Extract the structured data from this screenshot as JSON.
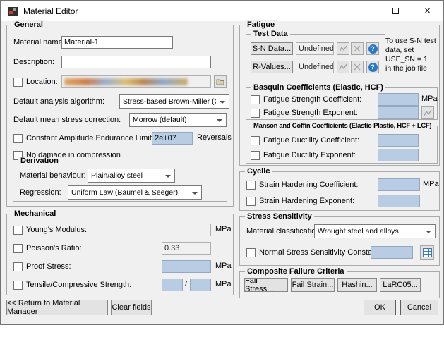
{
  "window": {
    "title": "Material Editor",
    "close_glyph": "×"
  },
  "icons": {
    "help_glyph": "?"
  },
  "colors": {
    "dialog_bg": "#f0f0f0",
    "field_blue": "#b8cce4",
    "help_icon_blue": "#2979c8",
    "calc_icon_blue": "#3b78c3"
  },
  "general": {
    "title": "General",
    "material_name": {
      "label": "Material name:",
      "value": "Material-1"
    },
    "description": {
      "label": "Description:",
      "value": ""
    },
    "location": {
      "label": "Location:"
    },
    "algorithm": {
      "label": "Default analysis algorithm:",
      "value": "Stress-based Brown-Miller (CP)"
    },
    "mean_stress": {
      "label": "Default mean stress correction:",
      "value": "Morrow (default)"
    },
    "endurance": {
      "label": "Constant Amplitude Endurance Limit:",
      "value": "2e+07",
      "unit": "Reversals"
    },
    "no_damage_label": "No damage in compression",
    "derivation": {
      "title": "Derivation",
      "behaviour": {
        "label": "Material behaviour:",
        "value": "Plain/alloy steel"
      },
      "regression": {
        "label": "Regression:",
        "value": "Uniform Law (Baumel & Seeger)"
      }
    }
  },
  "mechanical": {
    "title": "Mechanical",
    "youngs": {
      "label": "Young's Modulus:",
      "value": "",
      "unit": "MPa"
    },
    "poissons": {
      "label": "Poisson's Ratio:",
      "value": "0.33"
    },
    "proof": {
      "label": "Proof Stress:",
      "value": "",
      "unit": "MPa"
    },
    "tensile": {
      "label": "Tensile/Compressive Strength:",
      "value1": "",
      "separator": "/",
      "value2": "",
      "unit": "MPa"
    }
  },
  "fatigue": {
    "title": "Fatigue",
    "test_data": {
      "title": "Test Data",
      "sn": {
        "button": "S-N Data...",
        "value": "Undefined"
      },
      "r": {
        "button": "R-Values...",
        "value": "Undefined"
      },
      "note": "To use S-N test\ndata, set\nUSE_SN = 1\nin the job file"
    },
    "basquin": {
      "title": "Basquin Coefficients (Elastic, HCF)",
      "coefficient": {
        "label": "Fatigue Strength Coefficient:",
        "value": "",
        "unit": "MPa"
      },
      "exponent": {
        "label": "Fatigue Strength Exponent:",
        "value": ""
      }
    },
    "manson": {
      "title": "Manson and Coffin Coefficients (Elastic-Plastic, HCF + LCF)",
      "coefficient": {
        "label": "Fatigue Ductility Coefficient:",
        "value": ""
      },
      "exponent": {
        "label": "Fatigue Ductility Exponent:",
        "value": ""
      }
    }
  },
  "cyclic": {
    "title": "Cyclic",
    "coefficient": {
      "label": "Strain Hardening Coefficient:",
      "value": "",
      "unit": "MPa"
    },
    "exponent": {
      "label": "Strain Hardening Exponent:",
      "value": ""
    }
  },
  "stress_sensitivity": {
    "title": "Stress Sensitivity",
    "classification": {
      "label": "Material classification:",
      "value": "Wrought steel and alloys"
    },
    "nssc": {
      "label": "Normal Stress Sensitivity Constant:",
      "value": ""
    }
  },
  "composite": {
    "title": "Composite Failure Criteria",
    "buttons": [
      "Fail Stress...",
      "Fail Strain...",
      "Hashin...",
      "LaRC05..."
    ]
  },
  "footer": {
    "return_button": "<< Return to Material Manager",
    "clear_button": "Clear fields",
    "ok": "OK",
    "cancel": "Cancel"
  }
}
